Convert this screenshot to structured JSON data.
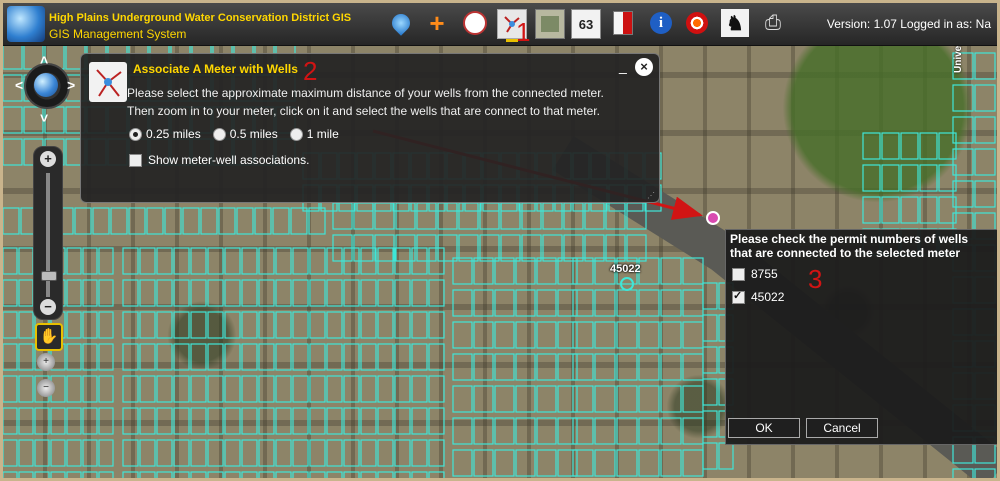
{
  "header": {
    "org_name": "High Plains Underground Water Conservation District GIS",
    "app_name": "GIS Management System",
    "status": "Version: 1.07   Logged in as: Na",
    "toolbar_icons": [
      "water-drop-icon",
      "add-icon",
      "gauge-icon",
      "meter-wells-icon",
      "map-icon",
      "label-63-icon",
      "book-icon",
      "info-icon",
      "target-icon",
      "person-icon",
      "print-icon"
    ],
    "toolbar_label_63": "63",
    "annotation_1": "1"
  },
  "dialog": {
    "title": "Associate A Meter with Wells",
    "annotation_2": "2",
    "line1": "Please select the approximate maximum distance of your wells from the connected meter.",
    "line2": "Then zoom in to your meter, click on it and select the wells that are connect to that meter.",
    "radios": [
      {
        "label": "0.25 miles",
        "selected": true
      },
      {
        "label": "0.5 miles",
        "selected": false
      },
      {
        "label": "1 mile",
        "selected": false
      }
    ],
    "show_assoc_label": "Show meter-well associations.",
    "show_assoc_checked": false,
    "minimize_glyph": "_",
    "close_glyph": "×"
  },
  "permits": {
    "heading": "Please check the permit numbers of wells that are connected to the selected meter",
    "annotation_3": "3",
    "items": [
      {
        "label": "8755",
        "checked": false
      },
      {
        "label": "45022",
        "checked": true
      }
    ],
    "ok_label": "OK",
    "cancel_label": "Cancel"
  },
  "map": {
    "well_label": "45022",
    "road_label": "University Ave"
  },
  "nav": {
    "zoom_in": "+",
    "zoom_out": "−"
  },
  "colors": {
    "title": "#ffd700",
    "parcel_outline": "#3fe6d8",
    "annotation": "#d11414"
  }
}
